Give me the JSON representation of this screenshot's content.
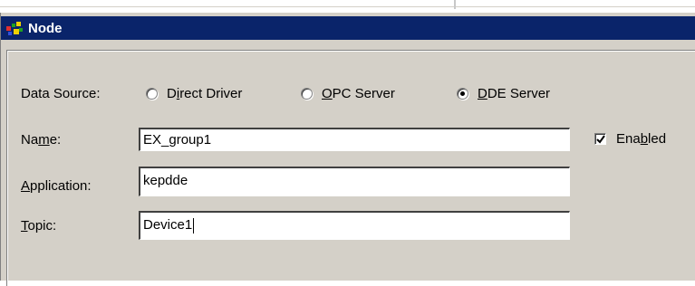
{
  "window": {
    "title": "Node",
    "icon": "node-app-icon"
  },
  "data_source": {
    "label": "Data Source:",
    "options": [
      {
        "pre": "D",
        "key": "i",
        "post": "rect Driver",
        "checked": false
      },
      {
        "pre": "",
        "key": "O",
        "post": "PC Server",
        "checked": false
      },
      {
        "pre": "",
        "key": "D",
        "post": "DE Server",
        "checked": true
      }
    ]
  },
  "name": {
    "label_pre": "Na",
    "label_key": "m",
    "label_post": "e:",
    "value": "EX_group1"
  },
  "enabled": {
    "label_pre": "Ena",
    "label_key": "b",
    "label_post": "led",
    "checked": true
  },
  "application": {
    "label_pre": "",
    "label_key": "A",
    "label_post": "pplication:",
    "value": "kepdde"
  },
  "topic": {
    "label_pre": "",
    "label_key": "T",
    "label_post": "opic:",
    "value": "Device1"
  },
  "colors": {
    "titlebar": "#0a246a",
    "face": "#d4d0c8"
  }
}
